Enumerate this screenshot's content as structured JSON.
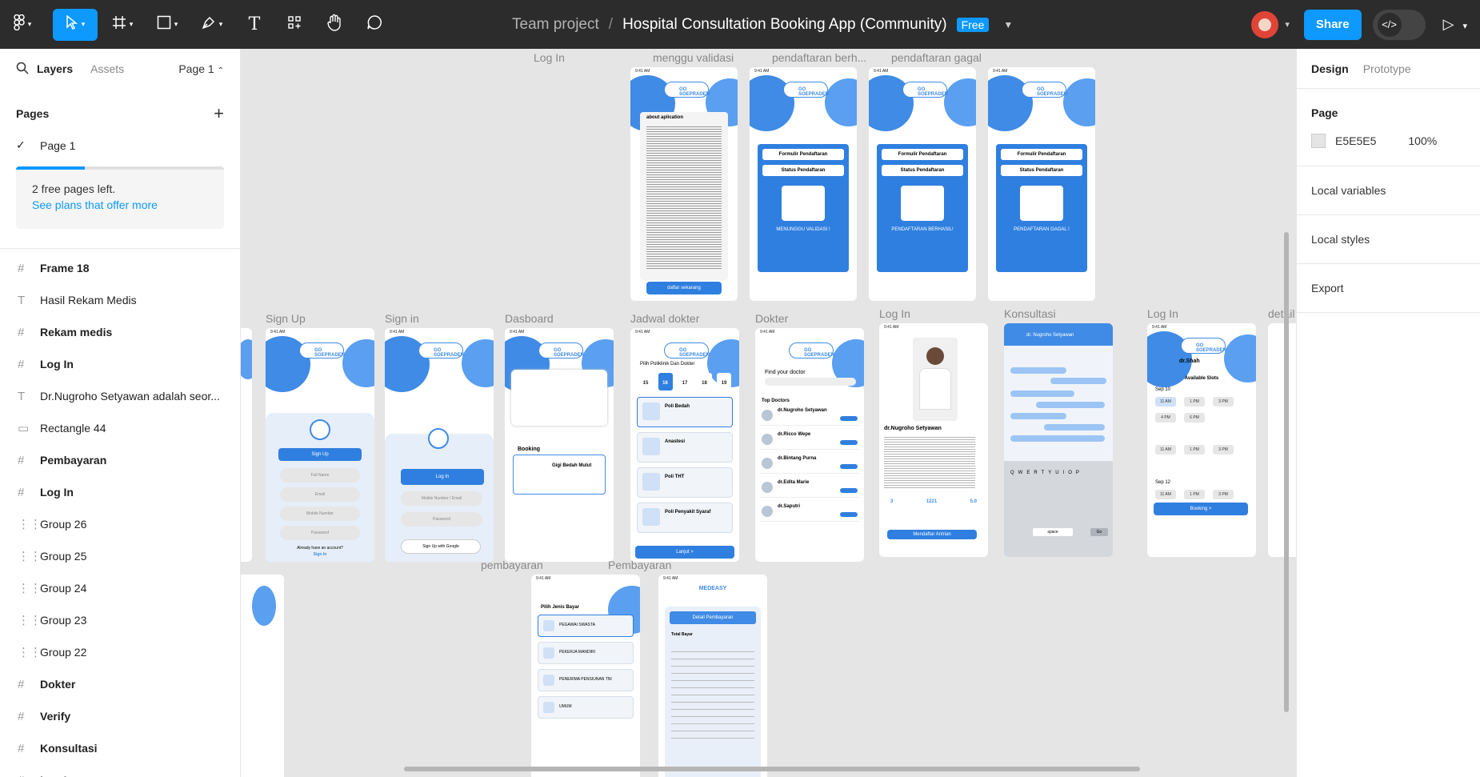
{
  "toolbar": {
    "team": "Team project",
    "separator": "/",
    "file_title": "Hospital Consultation Booking App (Community)",
    "plan_badge": "Free",
    "share_label": "Share",
    "tools": [
      "main-menu",
      "move",
      "frame",
      "shape",
      "pen",
      "text",
      "resources",
      "hand",
      "comment"
    ]
  },
  "left_panel": {
    "tab_layers": "Layers",
    "tab_assets": "Assets",
    "page_selector": "Page 1",
    "pages_heading": "Pages",
    "pages": [
      "Page 1"
    ],
    "free_pages_fill": 0.33,
    "upsell_line1": "2 free pages left.",
    "upsell_link": "See plans that offer more",
    "layers": [
      {
        "icon": "frame",
        "name": "Frame 18",
        "bold": true
      },
      {
        "icon": "text",
        "name": "Hasil Rekam Medis",
        "bold": false
      },
      {
        "icon": "frame",
        "name": "Rekam medis",
        "bold": true
      },
      {
        "icon": "frame",
        "name": "Log In",
        "bold": true
      },
      {
        "icon": "text",
        "name": "Dr.Nugroho Setyawan adalah seor...",
        "bold": false
      },
      {
        "icon": "rect",
        "name": "Rectangle 44",
        "bold": false
      },
      {
        "icon": "frame",
        "name": "Pembayaran",
        "bold": true
      },
      {
        "icon": "frame",
        "name": "Log In",
        "bold": true
      },
      {
        "icon": "group",
        "name": "Group 26",
        "bold": false
      },
      {
        "icon": "group",
        "name": "Group 25",
        "bold": false
      },
      {
        "icon": "group",
        "name": "Group 24",
        "bold": false
      },
      {
        "icon": "group",
        "name": "Group 23",
        "bold": false
      },
      {
        "icon": "group",
        "name": "Group 22",
        "bold": false
      },
      {
        "icon": "frame",
        "name": "Dokter",
        "bold": true
      },
      {
        "icon": "frame",
        "name": "Verify",
        "bold": true
      },
      {
        "icon": "frame",
        "name": "Konsultasi",
        "bold": true
      },
      {
        "icon": "frame",
        "name": "Log In",
        "bold": true
      }
    ]
  },
  "right_panel": {
    "tab_design": "Design",
    "tab_prototype": "Prototype",
    "page_heading": "Page",
    "bg_color": "E5E5E5",
    "bg_opacity": "100%",
    "local_variables": "Local variables",
    "local_styles": "Local styles",
    "export": "Export"
  },
  "canvas": {
    "frames": {
      "login_top": "Log In",
      "menunggu": "menggu validasi",
      "berhasil": "pendaftaran berh...",
      "gagal": "pendaftaran gagal",
      "signup": "Sign Up",
      "signin": "Sign in",
      "dashboard": "Dasboard",
      "jadwal": "Jadwal dokter",
      "dokter": "Dokter",
      "login_doc": "Log In",
      "konsultasi": "Konsultasi",
      "login_slot": "Log In",
      "detail": "detail",
      "pembayaran_lower": "pembayaran",
      "pembayaran_upper": "Pembayaran"
    },
    "content": {
      "about_title": "about aplication",
      "daftar_btn": "daftar sekarang",
      "formulir": "Formulir Pendaftaran",
      "status": "Status Pendaftaran",
      "menunggu_text": "MENUNGGU VALIDASI !",
      "berhasil_text": "PENDAFTARAN BERHASIL!",
      "gagal_text": "PENDAFTARAN GAGAL !",
      "signup_btn": "Sign Up",
      "full_name": "Full Name",
      "email": "Email",
      "mobile": "Mobile Number",
      "password": "Password",
      "have_account": "Already have an account?",
      "signin_link": "Sign In",
      "login_btn": "Log In",
      "mobile_email": "Mobile Number / Email",
      "google_btn": "Sign Up with Google",
      "booking": "Booking",
      "gigi": "Gigi Bedah Mulut",
      "pilih_poli": "Pilih Poliklinik Dan Dokter",
      "dates": [
        "15",
        "16",
        "17",
        "18",
        "19"
      ],
      "poli": [
        "Poli Bedah",
        "Anastesi",
        "Poli THT",
        "Poli Penyakit Syaraf"
      ],
      "lanjut": "Lanjut >",
      "find_doctor": "Find your doctor",
      "top_doctors": "Top Doctors",
      "doctors": [
        "dr.Nugroho Setyawan",
        "dr.Ricco Wepe",
        "dr.Bintang Purna",
        "dr.Edita Marie",
        "dr.Saputri"
      ],
      "doc_name": "dr.Nugroho Setyawan",
      "stats": [
        "3",
        "1221",
        "5.0"
      ],
      "mendaftar": "Mendaftar Antrian",
      "chat_name": "dr. Nugroho Setyawan",
      "keys_row1": "QWERTYUIOP",
      "space": "space",
      "go": "Go",
      "dr_shah": "dr.Shah",
      "available": "Available Slots",
      "sep10": "Sep 10",
      "sep12": "Sep 12",
      "slots": [
        "11 AM",
        "1 PM",
        "3 PM",
        "4 PM",
        "6 PM"
      ],
      "booking_btn": "Booking >",
      "jenis_bayar": "Pilih Jenis Bayar",
      "bayar_opts": [
        "PEGAWAI SWASTA",
        "PEKERJA MANDIRI",
        "PENERIMA PENSIUNAN TNI",
        "UMUM"
      ],
      "medeasy": "MEDEASY",
      "detail_pembayaran": "Detail Pembayaran",
      "total_bayar": "Total Bayar"
    }
  }
}
